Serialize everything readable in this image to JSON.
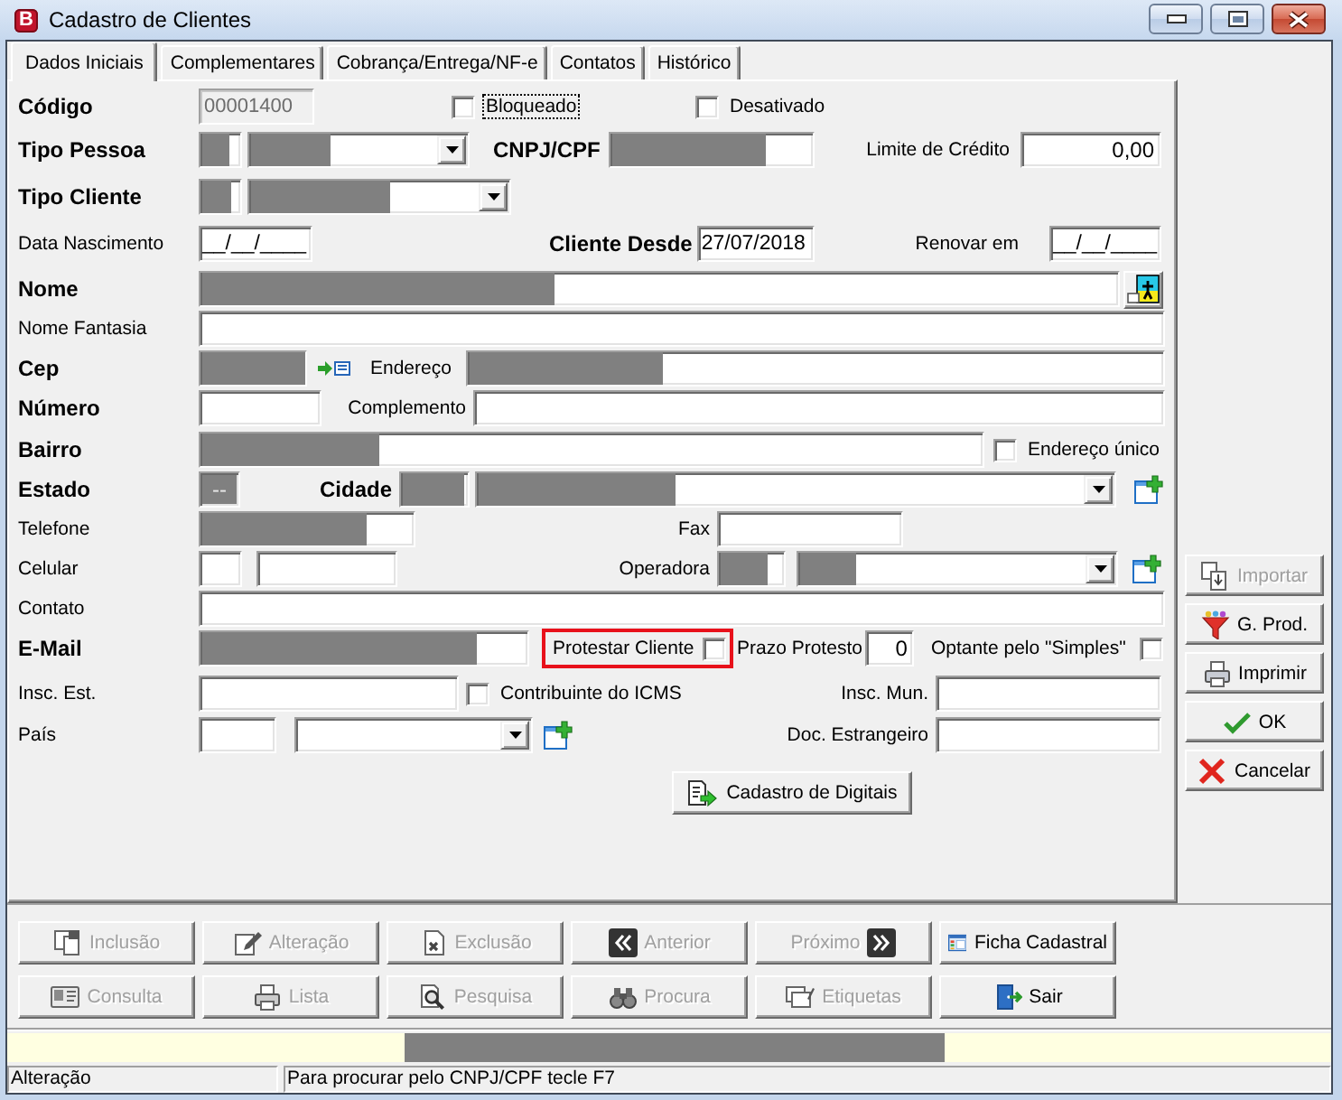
{
  "window": {
    "title": "Cadastro de Clientes",
    "icon_letter": "B"
  },
  "tabs": [
    {
      "label": "Dados Iniciais",
      "selected": true
    },
    {
      "label": "Complementares",
      "selected": false
    },
    {
      "label": "Cobrança/Entrega/NF-e",
      "selected": false
    },
    {
      "label": "Contatos",
      "selected": false
    },
    {
      "label": "Histórico",
      "selected": false
    }
  ],
  "form": {
    "codigo": {
      "label": "Código",
      "required": true,
      "value": "00001400",
      "disabled": true
    },
    "bloqueado": {
      "label": "Bloqueado",
      "checked": false,
      "focused": true
    },
    "desativado": {
      "label": "Desativado",
      "checked": false
    },
    "tipo_pessoa": {
      "label": "Tipo Pessoa",
      "required": true,
      "code": {
        "redacted": true
      },
      "option": {
        "redacted": true
      }
    },
    "cnpj_cpf": {
      "label": "CNPJ/CPF",
      "required": true,
      "redacted": true
    },
    "limite_credito": {
      "label": "Limite de Crédito",
      "required": false,
      "value": "0,00"
    },
    "tipo_cliente": {
      "label": "Tipo Cliente",
      "required": true,
      "code": {
        "redacted": true
      },
      "option": {
        "redacted": true
      }
    },
    "data_nascimento": {
      "label": "Data Nascimento",
      "required": false,
      "value": "__/__/____"
    },
    "cliente_desde": {
      "label": "Cliente Desde",
      "required": true,
      "value": "27/07/2018"
    },
    "renovar_em": {
      "label": "Renovar em",
      "required": false,
      "value": "__/__/____"
    },
    "nome": {
      "label": "Nome",
      "required": true,
      "redacted": true
    },
    "nome_fantasia": {
      "label": "Nome Fantasia",
      "required": false
    },
    "cep": {
      "label": "Cep",
      "required": true,
      "redacted": true
    },
    "endereco": {
      "label": "Endereço",
      "required": false,
      "redacted": true
    },
    "numero": {
      "label": "Número",
      "required": true
    },
    "complemento": {
      "label": "Complemento",
      "required": false
    },
    "bairro": {
      "label": "Bairro",
      "required": true,
      "redacted": true
    },
    "endereco_unico": {
      "label": "Endereço único",
      "checked": false
    },
    "estado": {
      "label": "Estado",
      "required": true,
      "value": "--",
      "redacted": true
    },
    "cidade": {
      "label": "Cidade",
      "required": true,
      "code": {
        "redacted": true
      },
      "option": {
        "redacted": true
      }
    },
    "telefone": {
      "label": "Telefone",
      "required": false,
      "redacted": true
    },
    "fax": {
      "label": "Fax",
      "required": false
    },
    "celular": {
      "label": "Celular",
      "required": false
    },
    "operadora": {
      "label": "Operadora",
      "required": false,
      "code": {
        "redacted": true
      },
      "option": {
        "redacted": true
      }
    },
    "contato": {
      "label": "Contato",
      "required": false
    },
    "email": {
      "label": "E-Mail",
      "required": true,
      "redacted": true
    },
    "protestar_cliente": {
      "label": "Protestar Cliente",
      "checked": false,
      "highlighted": true
    },
    "prazo_protesto": {
      "label": "Prazo Protesto",
      "required": false,
      "value": "0"
    },
    "optante_simples": {
      "label": "Optante pelo \"Simples\"",
      "checked": false
    },
    "insc_est": {
      "label": "Insc. Est.",
      "required": false
    },
    "contribuinte_icms": {
      "label": "Contribuinte do ICMS",
      "checked": false
    },
    "insc_mun": {
      "label": "Insc. Mun.",
      "required": false
    },
    "pais": {
      "label": "País",
      "required": false
    },
    "doc_estrangeiro": {
      "label": "Doc. Estrangeiro",
      "required": false
    }
  },
  "digitais_button": {
    "label": "Cadastro de Digitais"
  },
  "side_buttons": [
    {
      "kind": "import",
      "label": "Importar",
      "disabled": true
    },
    {
      "kind": "filter",
      "label": "G. Prod.",
      "disabled": false
    },
    {
      "kind": "print",
      "label": "Imprimir",
      "disabled": false
    },
    {
      "kind": "ok",
      "label": "OK",
      "disabled": false
    },
    {
      "kind": "cancel",
      "label": "Cancelar",
      "disabled": false
    }
  ],
  "nav_buttons": [
    {
      "kind": "include",
      "label": "Inclusão",
      "disabled": true
    },
    {
      "kind": "edit",
      "label": "Alteração",
      "disabled": true
    },
    {
      "kind": "delete",
      "label": "Exclusão",
      "disabled": true
    },
    {
      "kind": "prev",
      "label": "Anterior",
      "disabled": true
    },
    {
      "kind": "next",
      "label": "Próximo",
      "disabled": true
    },
    {
      "kind": "record",
      "label": "Ficha Cadastral",
      "disabled": false
    },
    {
      "kind": "query",
      "label": "Consulta",
      "disabled": true
    },
    {
      "kind": "list",
      "label": "Lista",
      "disabled": true
    },
    {
      "kind": "search",
      "label": "Pesquisa",
      "disabled": true
    },
    {
      "kind": "find",
      "label": "Procura",
      "disabled": true
    },
    {
      "kind": "labels",
      "label": "Etiquetas",
      "disabled": true
    },
    {
      "kind": "exit",
      "label": "Sair",
      "disabled": false
    }
  ],
  "hint_bar": {
    "redacted": true
  },
  "status_bar": [
    {
      "text": "Alteração"
    },
    {
      "text": "Para procurar pelo CNPJ/CPF tecle F7"
    }
  ]
}
